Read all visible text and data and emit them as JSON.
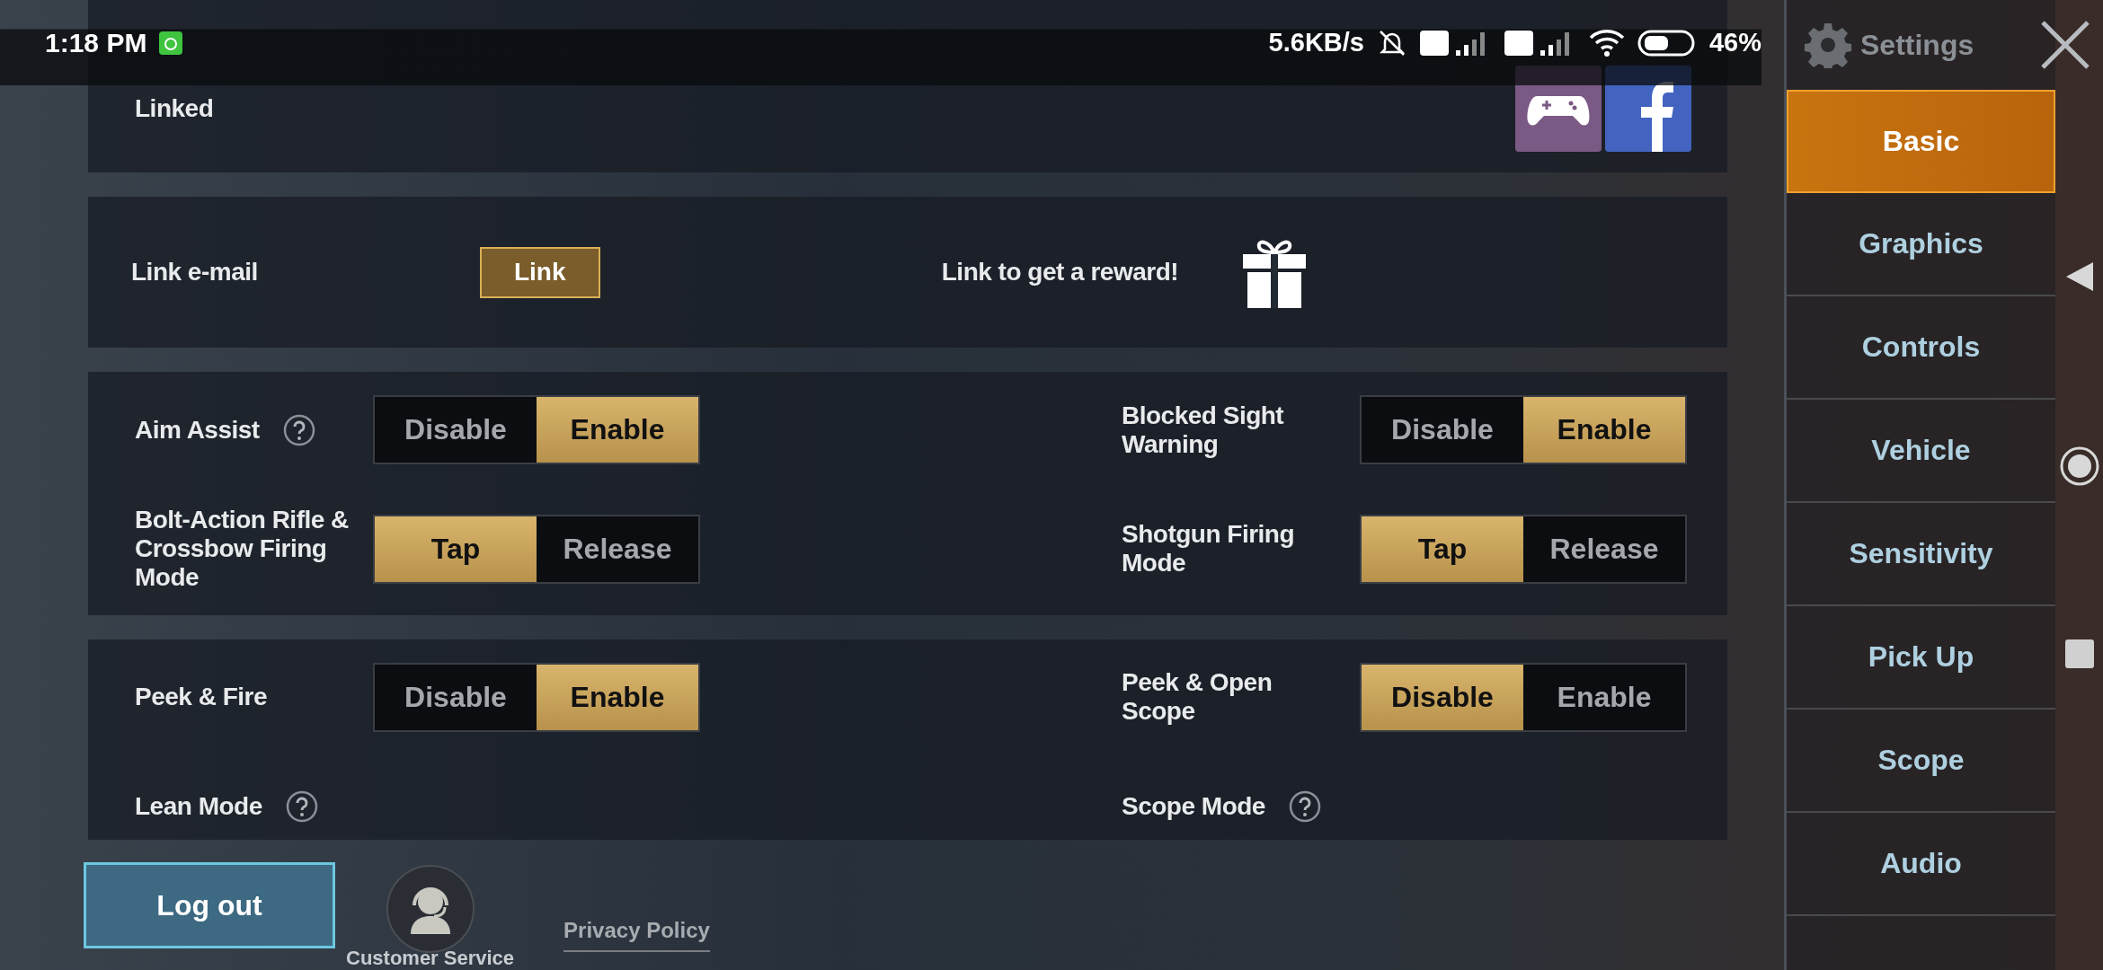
{
  "status_bar": {
    "time": "1:18 PM",
    "speed": "5.6KB/s",
    "battery": "46%"
  },
  "header": {
    "title": "Settings"
  },
  "sidebar": {
    "items": [
      {
        "label": "Basic",
        "selected": true
      },
      {
        "label": "Graphics",
        "selected": false
      },
      {
        "label": "Controls",
        "selected": false
      },
      {
        "label": "Vehicle",
        "selected": false
      },
      {
        "label": "Sensitivity",
        "selected": false
      },
      {
        "label": "Pick Up",
        "selected": false
      },
      {
        "label": "Scope",
        "selected": false
      },
      {
        "label": "Audio",
        "selected": false
      }
    ]
  },
  "sections": [
    {
      "kind": "linked",
      "label": "Linked"
    },
    {
      "kind": "link",
      "label": "Link e-mail",
      "button": "Link",
      "reward": "Link to get a reward!"
    },
    {
      "kind": "options",
      "settings": [
        {
          "label": "Aim Assist",
          "help": true,
          "options": [
            {
              "label": "Disable",
              "selected": false
            },
            {
              "label": "Enable",
              "selected": true
            }
          ]
        },
        {
          "label": "Blocked Sight Warning",
          "help": false,
          "options": [
            {
              "label": "Disable",
              "selected": false
            },
            {
              "label": "Enable",
              "selected": true
            }
          ]
        },
        {
          "label": "Bolt-Action Rifle & Crossbow Firing Mode",
          "help": false,
          "options": [
            {
              "label": "Tap",
              "selected": true
            },
            {
              "label": "Release",
              "selected": false
            }
          ]
        },
        {
          "label": "Shotgun Firing Mode",
          "help": false,
          "options": [
            {
              "label": "Tap",
              "selected": true
            },
            {
              "label": "Release",
              "selected": false
            }
          ]
        }
      ]
    },
    {
      "kind": "options",
      "settings": [
        {
          "label": "Peek & Fire",
          "help": false,
          "options": [
            {
              "label": "Disable",
              "selected": false
            },
            {
              "label": "Enable",
              "selected": true
            }
          ]
        },
        {
          "label": "Peek & Open Scope",
          "help": false,
          "options": [
            {
              "label": "Disable",
              "selected": true
            },
            {
              "label": "Enable",
              "selected": false
            }
          ]
        },
        {
          "label": "Lean Mode",
          "help": true
        },
        {
          "label": "Scope Mode",
          "help": true
        }
      ]
    }
  ],
  "footer": {
    "logout": "Log out",
    "customer_service": "Customer Service",
    "privacy": "Privacy Policy"
  }
}
